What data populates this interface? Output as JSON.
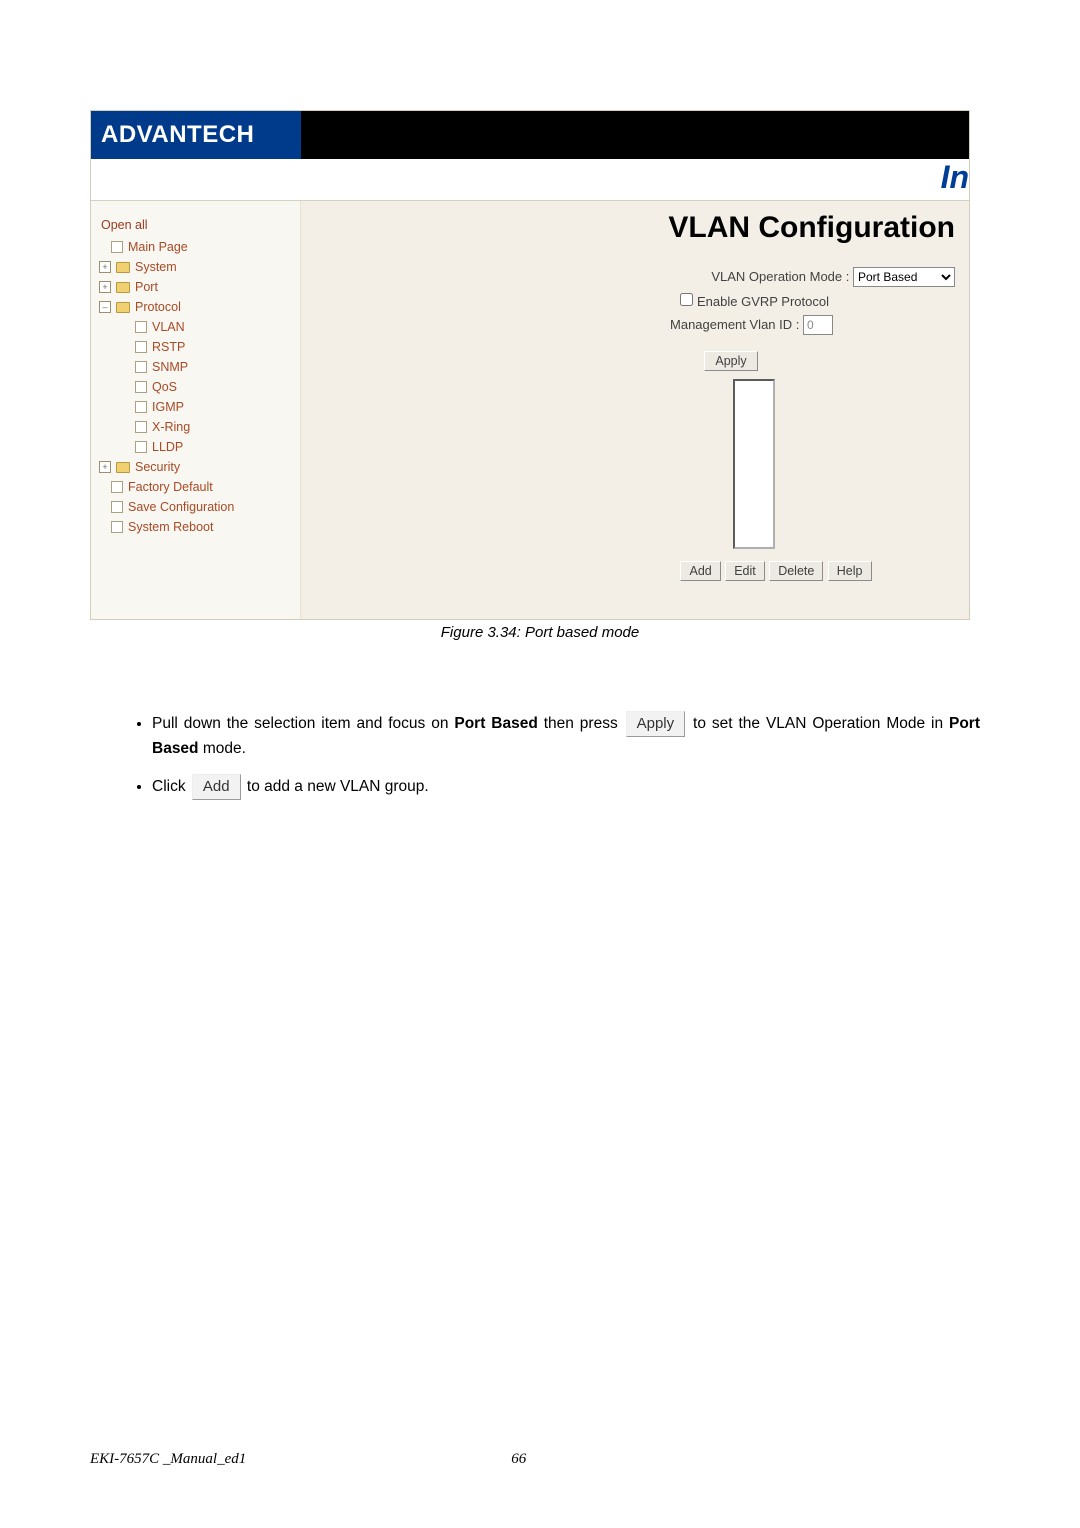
{
  "brand": "ADVANTECH",
  "corner_text": "In",
  "tree": {
    "open_all": "Open all",
    "main_page": "Main Page",
    "system": "System",
    "port": "Port",
    "protocol": "Protocol",
    "vlan": "VLAN",
    "rstp": "RSTP",
    "snmp": "SNMP",
    "qos": "QoS",
    "igmp": "IGMP",
    "xring": "X-Ring",
    "lldp": "LLDP",
    "security": "Security",
    "factory_default": "Factory Default",
    "save_config": "Save Configuration",
    "system_reboot": "System Reboot"
  },
  "main": {
    "title": "VLAN Configuration",
    "op_mode_label": "VLAN Operation Mode :",
    "op_mode_value": "Port Based",
    "gvrp_label": "Enable GVRP Protocol",
    "mgmt_label": "Management Vlan ID :",
    "mgmt_value": "0",
    "apply": "Apply",
    "add": "Add",
    "edit": "Edit",
    "delete": "Delete",
    "help": "Help"
  },
  "caption": "Figure 3.34: Port based mode",
  "instr": {
    "b1a": "Pull down the selection item and focus on ",
    "b1_strong1": "Port Based",
    "b1b": " then press ",
    "apply": "Apply",
    "b1c": " to set the VLAN Operation Mode in ",
    "b1_strong2": "Port Based",
    "b1d": " mode.",
    "b2a": "Click ",
    "add": "Add",
    "b2b": " to add a new VLAN group."
  },
  "footer": {
    "doc": "EKI-7657C _Manual_ed1",
    "page": "66"
  }
}
